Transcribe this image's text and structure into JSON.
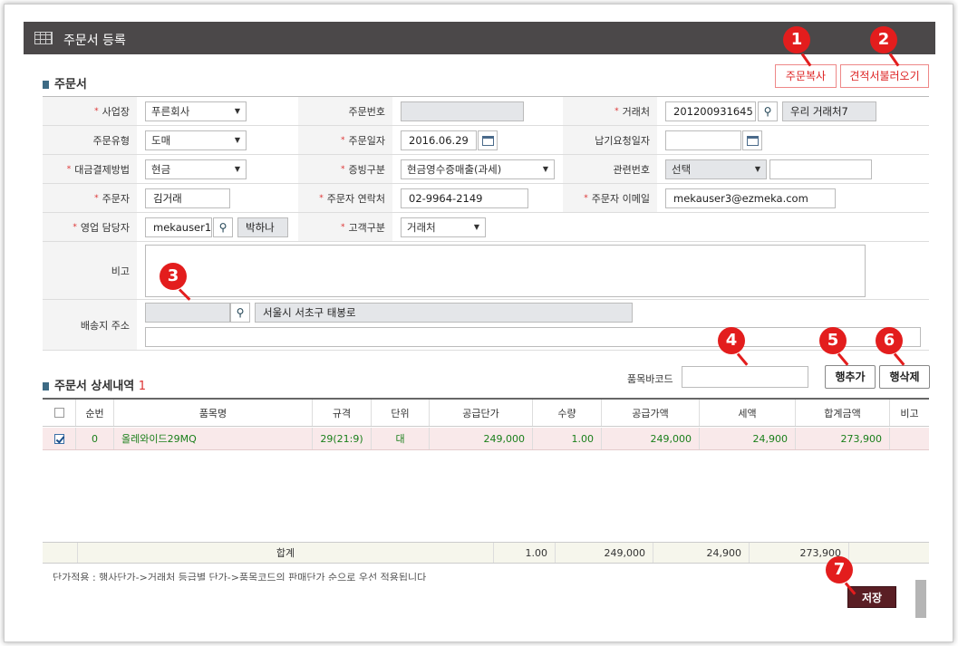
{
  "window": {
    "title": "주문서 등록"
  },
  "section_order": {
    "title": "주문서"
  },
  "top_buttons": {
    "copy": "주문복사",
    "load_quote": "견적서불러오기"
  },
  "badges": [
    "1",
    "2",
    "3",
    "4",
    "5",
    "6",
    "7"
  ],
  "form": {
    "business": {
      "label": "사업장",
      "value": "푸른회사"
    },
    "order_no": {
      "label": "주문번호",
      "value": ""
    },
    "client": {
      "label": "거래처",
      "code": "201200931645",
      "name": "우리 거래처7"
    },
    "order_type": {
      "label": "주문유형",
      "value": "도매"
    },
    "order_date": {
      "label": "주문일자",
      "value": "2016.06.29"
    },
    "delivery_date": {
      "label": "납기요청일자",
      "value": ""
    },
    "payment": {
      "label": "대금결제방법",
      "value": "현금"
    },
    "evidence": {
      "label": "증빙구분",
      "value": "현금영수증매출(과세)"
    },
    "related_no": {
      "label": "관련번호",
      "select": "선택",
      "value": ""
    },
    "orderer": {
      "label": "주문자",
      "value": "김거래"
    },
    "orderer_phone": {
      "label": "주문자 연락처",
      "value": "02-9964-2149"
    },
    "orderer_email": {
      "label": "주문자 이메일",
      "value": "mekauser3@ezmeka.com"
    },
    "sales_rep": {
      "label": "영업 담당자",
      "id": "mekauser1",
      "name": "박하나"
    },
    "customer_type": {
      "label": "고객구분",
      "value": "거래처"
    },
    "memo": {
      "label": "비고",
      "value": ""
    },
    "address": {
      "label": "배송지 주소",
      "zip": "",
      "addr1": "서울시 서초구 태봉로",
      "addr2": ""
    }
  },
  "section_detail": {
    "title": "주문서 상세내역",
    "count": "1"
  },
  "barcode": {
    "label": "품목바코드",
    "value": ""
  },
  "row_buttons": {
    "add": "행추가",
    "delete": "행삭제"
  },
  "grid": {
    "headers": [
      "순번",
      "품목명",
      "규격",
      "단위",
      "공급단가",
      "수량",
      "공급가액",
      "세액",
      "합계금액",
      "비고"
    ],
    "rows": [
      {
        "checked": true,
        "no": "0",
        "name": "올레와이드29MQ",
        "spec": "29(21:9)",
        "unit": "대",
        "price": "249,000",
        "qty": "1.00",
        "supply": "249,000",
        "tax": "24,900",
        "total": "273,900",
        "memo": ""
      }
    ],
    "footer": {
      "label": "합계",
      "qty": "1.00",
      "supply": "249,000",
      "tax": "24,900",
      "total": "273,900"
    }
  },
  "note": "단가적용 : 행사단가->거래처 등급별 단가->품목코드의 판매단가 순으로 우선 적용됩니다",
  "save_label": "저장",
  "colors": {
    "titlebar": "#4b4849",
    "badge": "#e31d1d",
    "save": "#5a1e24",
    "row_highlight": "#f9e9ea",
    "row_text": "#1a7f1a"
  }
}
